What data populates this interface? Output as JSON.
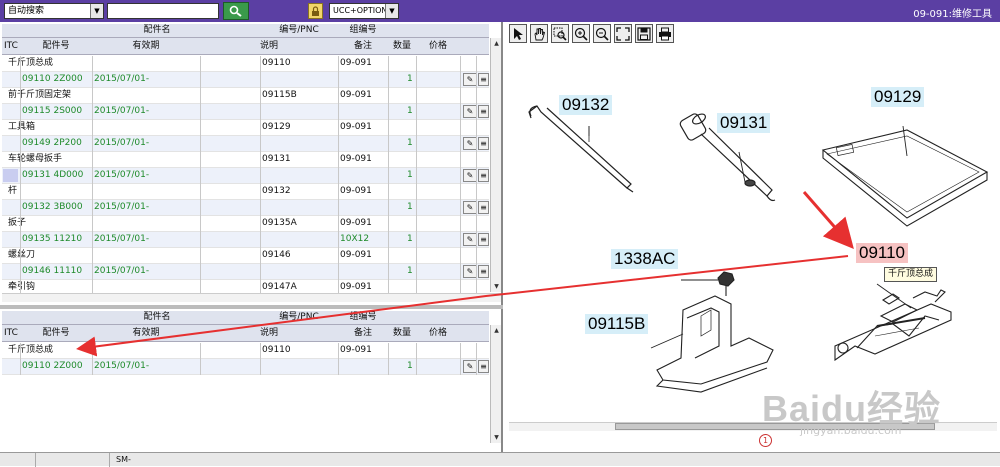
{
  "topbar": {
    "search_mode": "自动搜索",
    "search_value": "",
    "option": "UCC+OPTION",
    "title": "09-091:维修工具"
  },
  "grid_headers": {
    "group1": "配件名",
    "group2": "编号/PNC",
    "group3": "组编号",
    "itc": "ITC",
    "part_no": "配件号",
    "validity": "有效期",
    "desc": "说明",
    "note": "备注",
    "qty": "数量",
    "price": "价格"
  },
  "top_rows": [
    {
      "name": "千斤顶总成",
      "pnc": "09110",
      "group": "09-091",
      "part_no": "09110 2Z000",
      "date": "2015/07/01-",
      "note": "",
      "qty": "1"
    },
    {
      "name": "前千斤顶固定架",
      "pnc": "09115B",
      "group": "09-091",
      "part_no": "09115 2S000",
      "date": "2015/07/01-",
      "note": "",
      "qty": "1"
    },
    {
      "name": "工具箱",
      "pnc": "09129",
      "group": "09-091",
      "part_no": "09149 2P200",
      "date": "2015/07/01-",
      "note": "",
      "qty": "1"
    },
    {
      "name": "车轮螺母扳手",
      "pnc": "09131",
      "group": "09-091",
      "part_no": "09131 4D000",
      "date": "2015/07/01-",
      "note": "",
      "qty": "1"
    },
    {
      "name": "杆",
      "pnc": "09132",
      "group": "09-091",
      "part_no": "09132 3B000",
      "date": "2015/07/01-",
      "note": "",
      "qty": "1"
    },
    {
      "name": "扳子",
      "pnc": "09135A",
      "group": "09-091",
      "part_no": "09135 11210",
      "date": "2015/07/01-",
      "note": "10X12",
      "qty": "1"
    },
    {
      "name": "螺丝刀",
      "pnc": "09146",
      "group": "09-091",
      "part_no": "09146 11110",
      "date": "2015/07/01-",
      "note": "",
      "qty": "1"
    },
    {
      "name": "牵引钩",
      "pnc": "09147A",
      "group": "09-091"
    }
  ],
  "bottom_rows": [
    {
      "name": "千斤顶总成",
      "pnc": "09110",
      "group": "09-091",
      "part_no": "09110 2Z000",
      "date": "2015/07/01-",
      "note": "",
      "qty": "1"
    }
  ],
  "diagram": {
    "labels": [
      "09132",
      "09131",
      "09129",
      "09110",
      "1338AC",
      "09115B"
    ],
    "tooltip": "千斤顶总成",
    "page_marker": "1"
  },
  "status": {
    "text": "SM-"
  },
  "watermark": {
    "brand": "Baidu经验",
    "url": "jingyan.baidu.com"
  },
  "colors": {
    "header_bar": "#5b3fa3",
    "sub_text": "#1e8a2a",
    "arrow": "#e63030",
    "callout": "#d6eef8",
    "hot_callout": "#f6c2c2"
  }
}
